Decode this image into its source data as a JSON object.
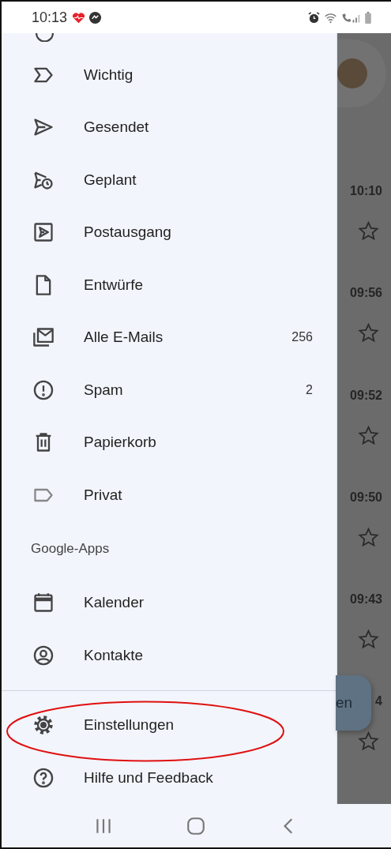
{
  "status_bar": {
    "time": "10:13"
  },
  "drawer": {
    "items": [
      {
        "kind": "important",
        "label": "Wichtig"
      },
      {
        "kind": "sent",
        "label": "Gesendet"
      },
      {
        "kind": "scheduled",
        "label": "Geplant"
      },
      {
        "kind": "outbox",
        "label": "Postausgang"
      },
      {
        "kind": "drafts",
        "label": "Entwürfe"
      },
      {
        "kind": "all-mail",
        "label": "Alle E-Mails",
        "count": "256"
      },
      {
        "kind": "spam",
        "label": "Spam",
        "count": "2"
      },
      {
        "kind": "trash",
        "label": "Papierkorb"
      },
      {
        "kind": "label",
        "label": "Privat"
      }
    ],
    "apps_header": "Google-Apps",
    "apps": [
      {
        "kind": "calendar",
        "label": "Kalender"
      },
      {
        "kind": "contacts",
        "label": "Kontakte"
      }
    ],
    "footer_items": [
      {
        "kind": "settings",
        "label": "Einstellungen"
      },
      {
        "kind": "help",
        "label": "Hilfe und Feedback"
      }
    ]
  },
  "background": {
    "emails": [
      {
        "time": "10:10"
      },
      {
        "time": "09:56"
      },
      {
        "time": "09:52"
      },
      {
        "time": "09:50"
      },
      {
        "time": "09:43"
      },
      {
        "time": "4"
      }
    ],
    "compose_button": {
      "label": "en"
    }
  }
}
